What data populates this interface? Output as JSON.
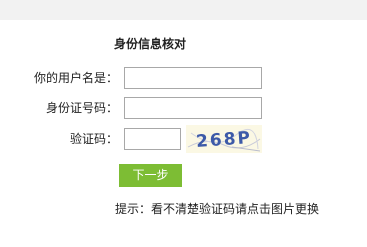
{
  "form": {
    "title": "身份信息核对",
    "username_label": "你的用户名是：",
    "username_value": "",
    "idnumber_label": "身份证号码：",
    "idnumber_value": "",
    "captcha_label": "验证码：",
    "captcha_value": "",
    "captcha_image_text": "268P",
    "next_button_label": "下一步",
    "hint": "提示：看不清楚验证码请点击图片更换"
  },
  "colors": {
    "top_band": "#f2f2f2",
    "button_bg": "#7dbd34",
    "button_text": "#ffffff",
    "captcha_bg": "#fbf8e4",
    "captcha_text": "#3d5aa8"
  }
}
